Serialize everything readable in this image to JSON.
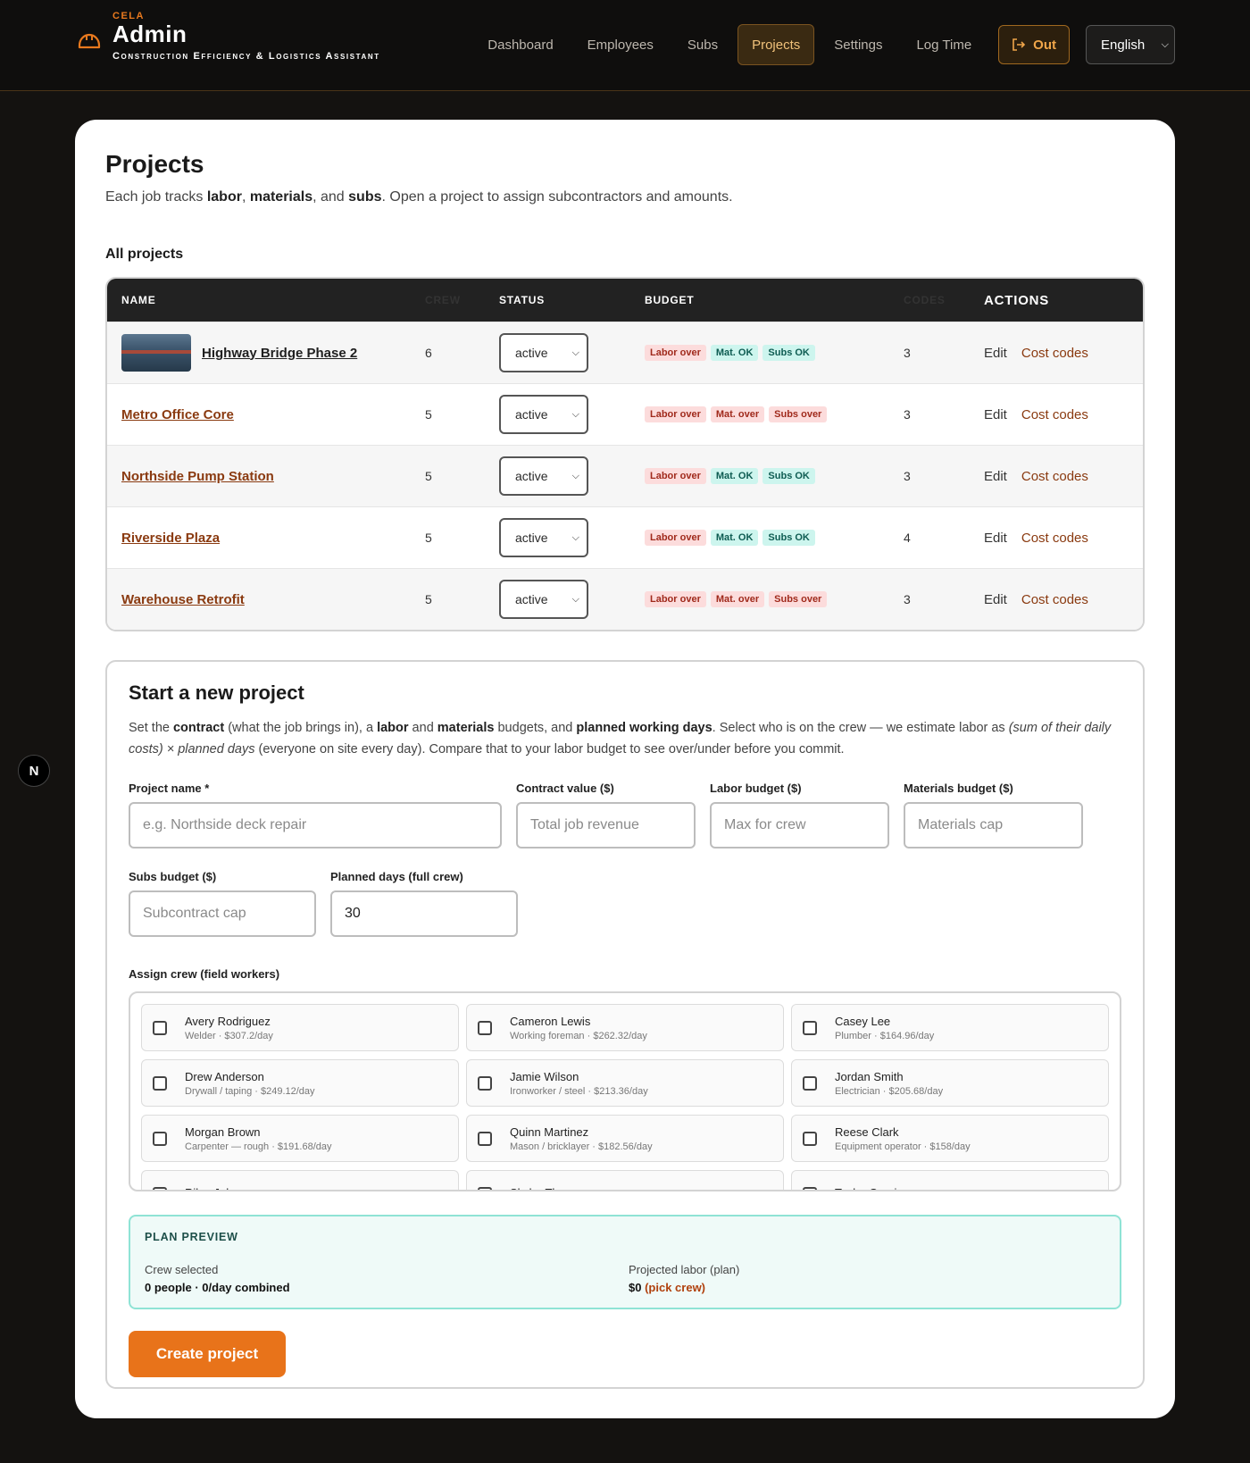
{
  "brand": {
    "small": "CELA",
    "title": "Admin",
    "subtitle": "Construction Efficiency & Logistics Assistant"
  },
  "nav": {
    "items": [
      "Dashboard",
      "Employees",
      "Subs",
      "Projects",
      "Settings",
      "Log Time"
    ],
    "active": "Projects",
    "out_label": "Out",
    "language": "English"
  },
  "page": {
    "title": "Projects",
    "desc_pre": "Each job tracks ",
    "desc_b1": "labor",
    "desc_sep1": ", ",
    "desc_b2": "materials",
    "desc_sep2": ", and ",
    "desc_b3": "subs",
    "desc_post": ". Open a project to assign subcontractors and amounts.",
    "section_label": "All projects"
  },
  "table": {
    "headers": [
      "NAME",
      "CREW",
      "STATUS",
      "BUDGET",
      "CODES",
      "ACTIONS"
    ],
    "rows": [
      {
        "name": "Highway Bridge Phase 2",
        "crew": "6",
        "status": "active",
        "badges": [
          [
            "Labor over",
            "over"
          ],
          [
            "Mat. OK",
            "ok"
          ],
          [
            "Subs OK",
            "ok"
          ]
        ],
        "codes": "3",
        "edit": "Edit",
        "cost": "Cost codes"
      },
      {
        "name": "Metro Office Core",
        "crew": "5",
        "status": "active",
        "badges": [
          [
            "Labor over",
            "over"
          ],
          [
            "Mat. over",
            "over"
          ],
          [
            "Subs over",
            "over"
          ]
        ],
        "codes": "3",
        "edit": "Edit",
        "cost": "Cost codes"
      },
      {
        "name": "Northside Pump Station",
        "crew": "5",
        "status": "active",
        "badges": [
          [
            "Labor over",
            "over"
          ],
          [
            "Mat. OK",
            "ok"
          ],
          [
            "Subs OK",
            "ok"
          ]
        ],
        "codes": "3",
        "edit": "Edit",
        "cost": "Cost codes"
      },
      {
        "name": "Riverside Plaza",
        "crew": "5",
        "status": "active",
        "badges": [
          [
            "Labor over",
            "over"
          ],
          [
            "Mat. OK",
            "ok"
          ],
          [
            "Subs OK",
            "ok"
          ]
        ],
        "codes": "4",
        "edit": "Edit",
        "cost": "Cost codes"
      },
      {
        "name": "Warehouse Retrofit",
        "crew": "5",
        "status": "active",
        "badges": [
          [
            "Labor over",
            "over"
          ],
          [
            "Mat. over",
            "over"
          ],
          [
            "Subs over",
            "over"
          ]
        ],
        "codes": "3",
        "edit": "Edit",
        "cost": "Cost codes"
      }
    ]
  },
  "form": {
    "title": "Start a new project",
    "desc": {
      "t1": "Set the ",
      "b1": "contract",
      "t2": " (what the job brings in), a ",
      "b2": "labor",
      "t3": " and ",
      "b3": "materials",
      "t4": " budgets, and ",
      "b4": "planned working days",
      "t5": ". Select who is on the crew — we estimate labor as ",
      "i1": "(sum of their daily costs) × planned days",
      "t6": " (everyone on site every day). Compare that to your labor budget to see over/under before you commit."
    },
    "fields": {
      "name": {
        "label": "Project name *",
        "placeholder": "e.g. Northside deck repair",
        "value": ""
      },
      "contract": {
        "label": "Contract value ($)",
        "placeholder": "Total job revenue",
        "value": ""
      },
      "labor": {
        "label": "Labor budget ($)",
        "placeholder": "Max for crew",
        "value": ""
      },
      "materials": {
        "label": "Materials budget ($)",
        "placeholder": "Materials cap",
        "value": ""
      },
      "subs": {
        "label": "Subs budget ($)",
        "placeholder": "Subcontract cap",
        "value": ""
      },
      "days": {
        "label": "Planned days (full crew)",
        "placeholder": "",
        "value": "30"
      }
    },
    "crew_label": "Assign crew (field workers)",
    "crew": [
      {
        "name": "Avery Rodriguez",
        "meta": "Welder · $307.2/day"
      },
      {
        "name": "Cameron Lewis",
        "meta": "Working foreman · $262.32/day"
      },
      {
        "name": "Casey Lee",
        "meta": "Plumber · $164.96/day"
      },
      {
        "name": "Drew Anderson",
        "meta": "Drywall / taping · $249.12/day"
      },
      {
        "name": "Jamie Wilson",
        "meta": "Ironworker / steel · $213.36/day"
      },
      {
        "name": "Jordan Smith",
        "meta": "Electrician · $205.68/day"
      },
      {
        "name": "Morgan Brown",
        "meta": "Carpenter — rough · $191.68/day"
      },
      {
        "name": "Quinn Martinez",
        "meta": "Mason / bricklayer · $182.56/day"
      },
      {
        "name": "Reese Clark",
        "meta": "Equipment operator · $158/day"
      },
      {
        "name": "Riley Johnson",
        "meta": ""
      },
      {
        "name": "Skyler Thomas",
        "meta": ""
      },
      {
        "name": "Taylor Garcia",
        "meta": ""
      }
    ],
    "preview": {
      "title": "PLAN PREVIEW",
      "crew_label": "Crew selected",
      "crew_value": "0 people · 0/day combined",
      "labor_label": "Projected labor (plan)",
      "labor_value": "$0",
      "labor_hint": "(pick crew)"
    },
    "create_label": "Create project"
  },
  "side_badge": "N",
  "colors": {
    "accent": "#e8731a",
    "link": "#8a3a10",
    "over_bg": "#fcdcdc",
    "ok_bg": "#cdf5ee"
  }
}
